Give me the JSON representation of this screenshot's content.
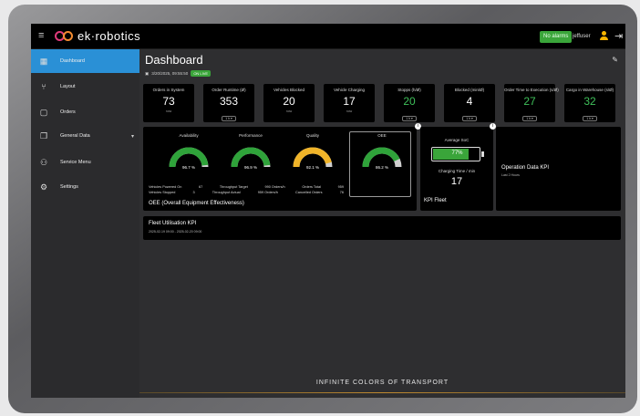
{
  "header": {
    "app_name": "ek·robotics",
    "alarm_badge": "No alarms",
    "username": "jeffuser"
  },
  "sidebar": {
    "items": [
      {
        "label": "Dashboard",
        "icon": "dashboard-grid-icon",
        "active": true
      },
      {
        "label": "Layout",
        "icon": "layout-fork-icon"
      },
      {
        "label": "Orders",
        "icon": "clipboard-icon"
      },
      {
        "label": "General Data",
        "icon": "copy-stack-icon"
      },
      {
        "label": "Service Menu",
        "icon": "service-users-icon"
      },
      {
        "label": "Settings",
        "icon": "gear-icon"
      }
    ]
  },
  "page": {
    "title": "Dashboard",
    "datetime": "3/20/2025, 09:55:50",
    "live_badge": "ON LIVE"
  },
  "kpis": [
    {
      "label": "Orders in System",
      "value": "73",
      "sub": "now",
      "green": false,
      "select": false
    },
    {
      "label": "Order Runtime (Ø)",
      "value": "353",
      "sub": "1 h ▾",
      "green": false,
      "select": true
    },
    {
      "label": "Vehicles Blocked",
      "value": "20",
      "sub": "now",
      "green": false,
      "select": false
    },
    {
      "label": "Vehicle Charging",
      "value": "17",
      "sub": "now",
      "green": false,
      "select": false
    },
    {
      "label": "Stopps (h/Ø)",
      "value": "20",
      "sub": "1 h ▾",
      "green": true,
      "select": true
    },
    {
      "label": "Blocked (min/Ø)",
      "value": "4",
      "sub": "1 h ▾",
      "green": false,
      "select": true
    },
    {
      "label": "Order Time to Execution (s/Ø)",
      "value": "27",
      "sub": "1 h ▾",
      "green": true,
      "select": true
    },
    {
      "label": "Cargo in Warehouse (s/Ø)",
      "value": "32",
      "sub": "1 h ▾",
      "green": true,
      "select": true
    }
  ],
  "oee": {
    "title": "OEE (Overall Equipment Effectiveness)",
    "gauges": [
      {
        "label": "Availability",
        "value": "96.7 %",
        "fraction": 0.967,
        "color": "#2fa33a"
      },
      {
        "label": "Performance",
        "value": "96.9 %",
        "fraction": 0.969,
        "color": "#2fa33a"
      },
      {
        "label": "Quality",
        "value": "92.1 %",
        "fraction": 0.921,
        "color": "#f0b429"
      },
      {
        "label": "OEE",
        "value": "86.2 %",
        "fraction": 0.862,
        "color": "#2fa33a"
      }
    ],
    "stats": [
      [
        "Vehicles Powered On",
        "67",
        "Throughput Target",
        "990 Orders/h",
        "Orders Total",
        "959"
      ],
      [
        "Vehicles Stopped",
        "3",
        "Throughput Actual",
        "959 Orders/h",
        "Cancelled Orders",
        "76"
      ]
    ],
    "info": "i"
  },
  "fleet": {
    "soc_label": "Average SoC",
    "soc_value": "77%",
    "soc_fraction": 0.77,
    "charging_label": "Charging Time / min",
    "charging_value": "17",
    "title": "KPI Fleet",
    "info": "i"
  },
  "operation": {
    "title": "Operation Data KPI",
    "sub": "Last 2 Hours"
  },
  "utilisation": {
    "title": "Fleet Utilisation KPI",
    "range": "2025-02-19 09:00 - 2025-02-20 09:00"
  },
  "footer": {
    "tagline": "INFINITE COLORS OF TRANSPORT"
  },
  "icons": {
    "menu": "hamburger-menu-icon",
    "edit": "pencil-icon",
    "user": "user-icon",
    "logout": "logout-icon",
    "calendar": "calendar-icon"
  }
}
